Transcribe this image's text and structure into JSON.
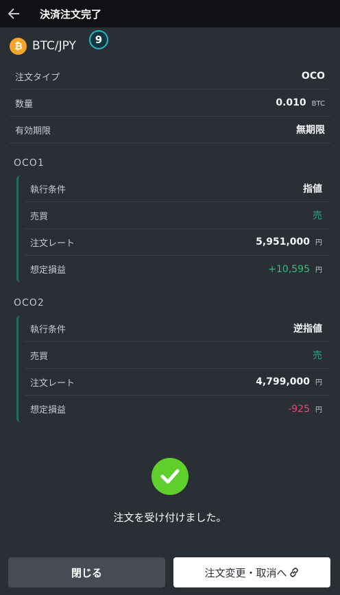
{
  "header": {
    "title": "決済注文完了"
  },
  "pair": {
    "label": "BTC/JPY",
    "badge": "9"
  },
  "summary": [
    {
      "label": "注文タイプ",
      "value": "OCO",
      "unit": ""
    },
    {
      "label": "数量",
      "value": "0.010",
      "unit": "BTC"
    },
    {
      "label": "有効期限",
      "value": "無期限",
      "unit": ""
    }
  ],
  "oco1": {
    "title": "OCO1",
    "rows": [
      {
        "label": "執行条件",
        "value": "指値",
        "unit": ""
      },
      {
        "label": "売買",
        "value": "売",
        "unit": ""
      },
      {
        "label": "注文レート",
        "value": "5,951,000",
        "unit": "円"
      },
      {
        "label": "想定損益",
        "value": "+10,595",
        "unit": "円"
      }
    ]
  },
  "oco2": {
    "title": "OCO2",
    "rows": [
      {
        "label": "執行条件",
        "value": "逆指値",
        "unit": ""
      },
      {
        "label": "売買",
        "value": "売",
        "unit": ""
      },
      {
        "label": "注文レート",
        "value": "4,799,000",
        "unit": "円"
      },
      {
        "label": "想定損益",
        "value": "-925",
        "unit": "円"
      }
    ]
  },
  "message": "注文を受け付けました。",
  "buttons": {
    "close": "閉じる",
    "change": "注文変更・取消へ"
  },
  "colors": {
    "profit": "#2ec27e",
    "loss": "#e74973",
    "side": "#2ca58d",
    "success": "#5fcf2c",
    "coin": "#f2a52a"
  }
}
